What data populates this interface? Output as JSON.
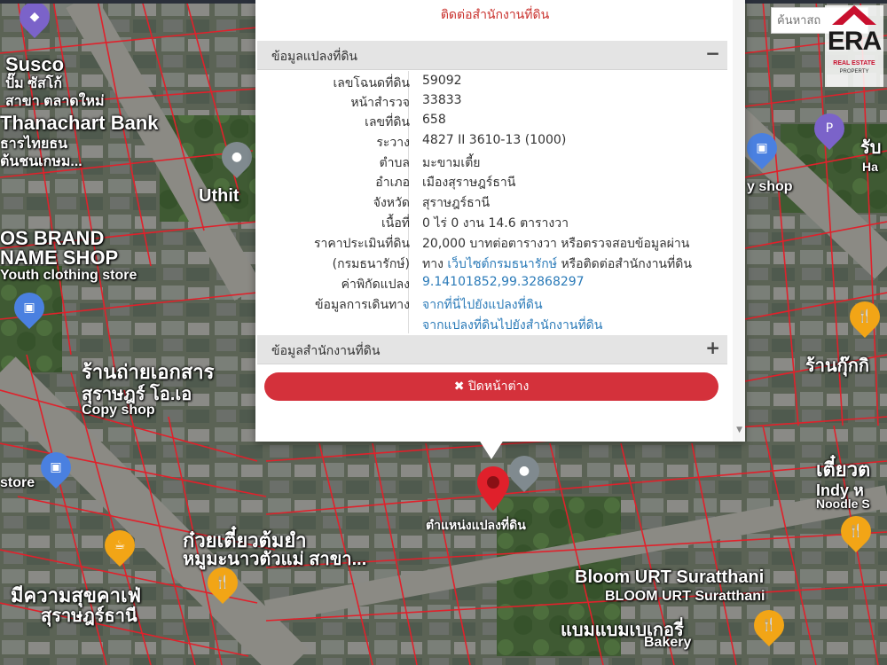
{
  "map": {
    "labels": [
      {
        "text": "Susco"
      },
      {
        "text": "ปั๊ม ซัสโก้"
      },
      {
        "text": "สาขา ตลาดใหม่"
      },
      {
        "text": "Thanachart Bank"
      },
      {
        "text": "ธารไทยธน"
      },
      {
        "text": "ต้นชนเกษม..."
      },
      {
        "text": "Uthit"
      },
      {
        "text": "OS BRAND"
      },
      {
        "text": "NAME SHOP"
      },
      {
        "text": "Youth clothing store"
      },
      {
        "text": "ร้านถ่ายเอกสาร"
      },
      {
        "text": "สุราษฎร์ โอ.เอ"
      },
      {
        "text": "Copy shop"
      },
      {
        "text": "store"
      },
      {
        "text": "ก๋วยเตี๋ยวต้มยำ"
      },
      {
        "text": "หมูมะนาวตัวแม่ สาขา..."
      },
      {
        "text": "มีความสุขคาเฟ่"
      },
      {
        "text": "สุราษฎร์ธานี"
      },
      {
        "text": "Bloom URT Suratthani"
      },
      {
        "text": "BLOOM URT Suratthani"
      },
      {
        "text": "แบมแบมเบเกอรี่"
      },
      {
        "text": "Bakery"
      },
      {
        "text": "รับ"
      },
      {
        "text": "Ha"
      },
      {
        "text": "y shop"
      },
      {
        "text": "ร้านกุ๊กกิ"
      },
      {
        "text": "เตี๋ยวต"
      },
      {
        "text": "Indy ห"
      },
      {
        "text": "Noodle S"
      }
    ],
    "marker_label": "ตำแหน่งแปลงที่ดิน"
  },
  "search": {
    "placeholder": "ค้นหาสถ"
  },
  "logo": {
    "brand": "ERA",
    "tagline": "REAL ESTATE",
    "sub": "PROPERTY"
  },
  "popup": {
    "contact_link": "ติดต่อสำนักงานที่ดิน",
    "section1": {
      "title": "ข้อมูลแปลงที่ดิน",
      "toggle": "−"
    },
    "rows": [
      {
        "label": "เลขโฉนดที่ดิน",
        "value": "59092"
      },
      {
        "label": "หน้าสำรวจ",
        "value": "33833"
      },
      {
        "label": "เลขที่ดิน",
        "value": "658"
      },
      {
        "label": "ระวาง",
        "value": "4827 II 3610-13 (1000)"
      },
      {
        "label": "ตำบล",
        "value": "มะขามเตี้ย"
      },
      {
        "label": "อำเภอ",
        "value": "เมืองสุราษฎร์ธานี"
      },
      {
        "label": "จังหวัด",
        "value": "สุราษฎร์ธานี"
      },
      {
        "label": "เนื้อที่",
        "value": "0 ไร่ 0 งาน 14.6 ตารางวา"
      },
      {
        "label": "ราคาประเมินที่ดิน",
        "value": "20,000 บาทต่อตารางวา หรือตรวจสอบข้อมูลผ่าน"
      },
      {
        "label": "(กรมธนารักษ์)",
        "value_prefix": "ทาง",
        "value_link": "เว็บไซต์กรมธนารักษ์",
        "value_suffix": "หรือติดต่อสำนักงานที่ดิน"
      },
      {
        "label": "ค่าพิกัดแปลง",
        "value": "9.14101852,99.32868297"
      },
      {
        "label": "ข้อมูลการเดินทาง",
        "value": "จากที่นี่ไปยังแปลงที่ดิน"
      },
      {
        "label": "",
        "value": "จากแปลงที่ดินไปยังสำนักงานที่ดิน"
      }
    ],
    "section2": {
      "title": "ข้อมูลสำนักงานที่ดิน",
      "toggle": "+"
    },
    "close_button": {
      "icon": "close-icon",
      "label": "ปิดหน้าต่าง"
    }
  }
}
